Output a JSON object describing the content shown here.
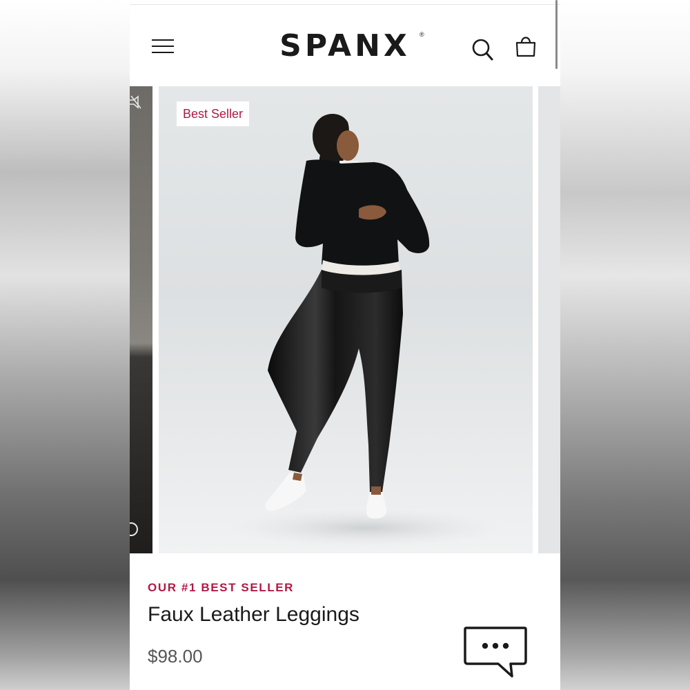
{
  "header": {
    "logo_text": "SPANX",
    "logo_mark": "®",
    "menu_icon": "hamburger-menu-icon",
    "search_icon": "search-icon",
    "bag_icon": "shopping-bag-icon"
  },
  "product": {
    "badge": "Best Seller",
    "eyebrow": "OUR #1 BEST SELLER",
    "title": "Faux Leather Leggings",
    "price": "$98.00"
  },
  "chat": {
    "icon": "chat-bubble-icon"
  },
  "colors": {
    "accent": "#b01945",
    "text": "#1a1a1a",
    "price": "#555555"
  }
}
